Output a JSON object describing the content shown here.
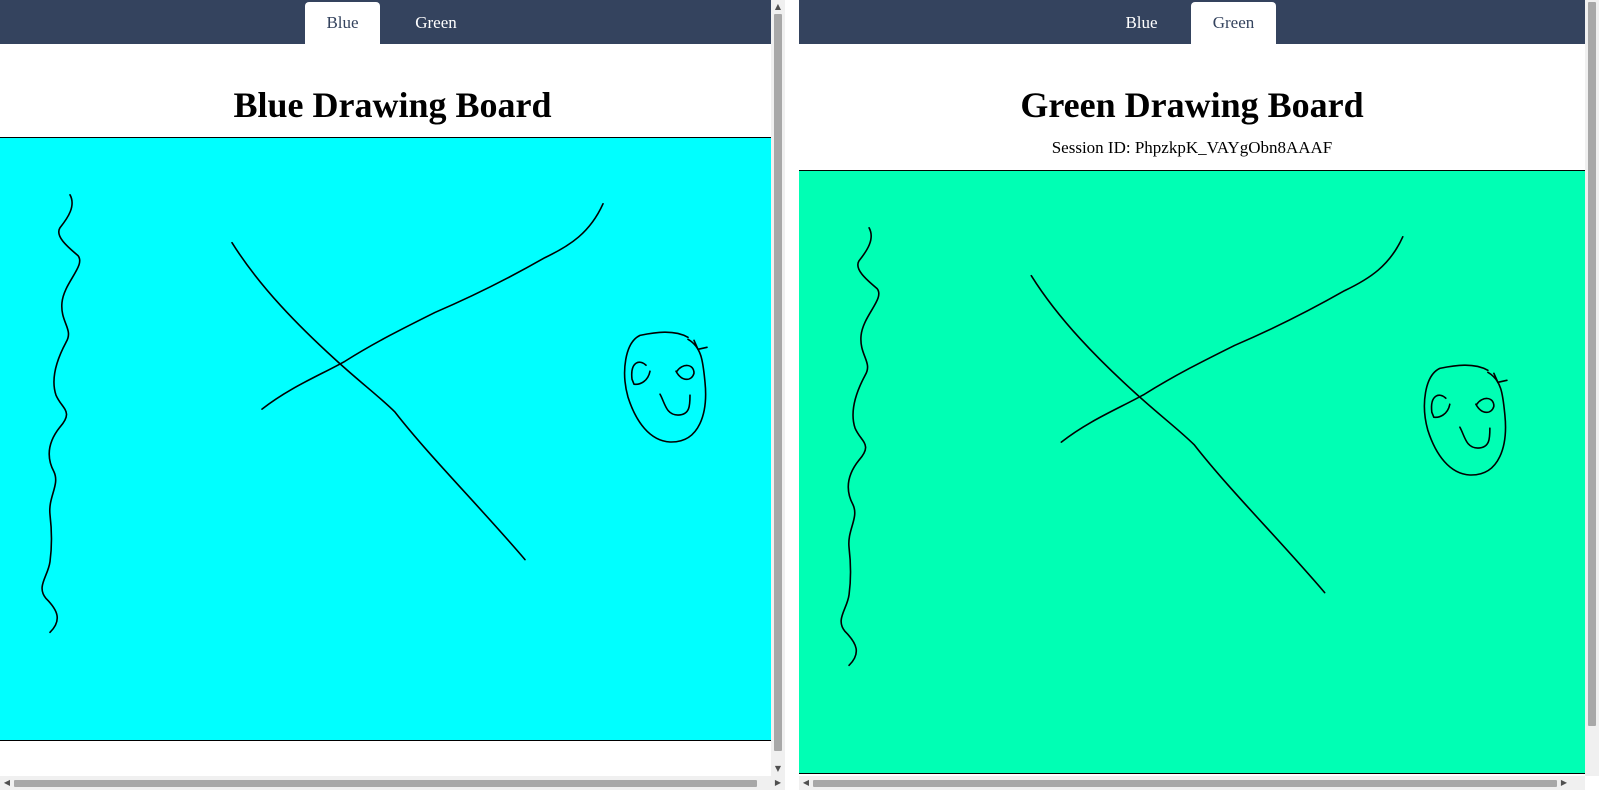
{
  "left_pane": {
    "tabs": [
      {
        "label": "Blue",
        "active": true
      },
      {
        "label": "Green",
        "active": false
      }
    ],
    "title": "Blue Drawing Board",
    "canvas_color": "#00ffff"
  },
  "right_pane": {
    "tabs": [
      {
        "label": "Blue",
        "active": false
      },
      {
        "label": "Green",
        "active": true
      }
    ],
    "title": "Green Drawing Board",
    "session_id": "Session ID: PhpzkpK_VAYgObn8AAAF",
    "canvas_color": "#00ffb4"
  },
  "colors": {
    "navbar": "#34435e",
    "ink": "#000000"
  },
  "icons": {
    "scroll_up": "▲",
    "scroll_down": "▼",
    "scroll_left": "◀",
    "scroll_right": "▶"
  }
}
